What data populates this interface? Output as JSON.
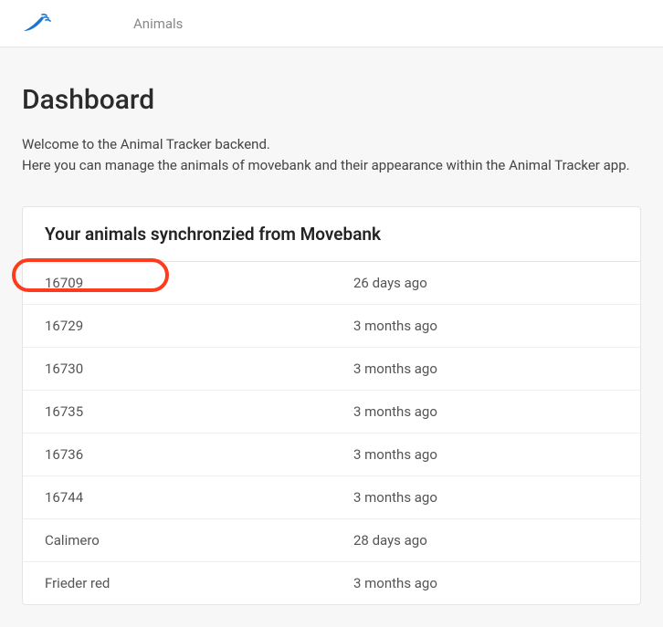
{
  "nav": {
    "link_animals": "Animals"
  },
  "page": {
    "title": "Dashboard",
    "intro_line1": "Welcome to the Animal Tracker backend.",
    "intro_line2": "Here you can manage the animals of movebank and their appearance within the Animal Tracker app."
  },
  "card": {
    "title": "Your animals synchronzied from Movebank"
  },
  "animals": [
    {
      "name": "16709",
      "time": "26 days ago",
      "highlighted": true
    },
    {
      "name": "16729",
      "time": "3 months ago"
    },
    {
      "name": "16730",
      "time": "3 months ago"
    },
    {
      "name": "16735",
      "time": "3 months ago"
    },
    {
      "name": "16736",
      "time": "3 months ago"
    },
    {
      "name": "16744",
      "time": "3 months ago"
    },
    {
      "name": "Calimero",
      "time": "28 days ago"
    },
    {
      "name": "Frieder red",
      "time": "3 months ago"
    }
  ]
}
